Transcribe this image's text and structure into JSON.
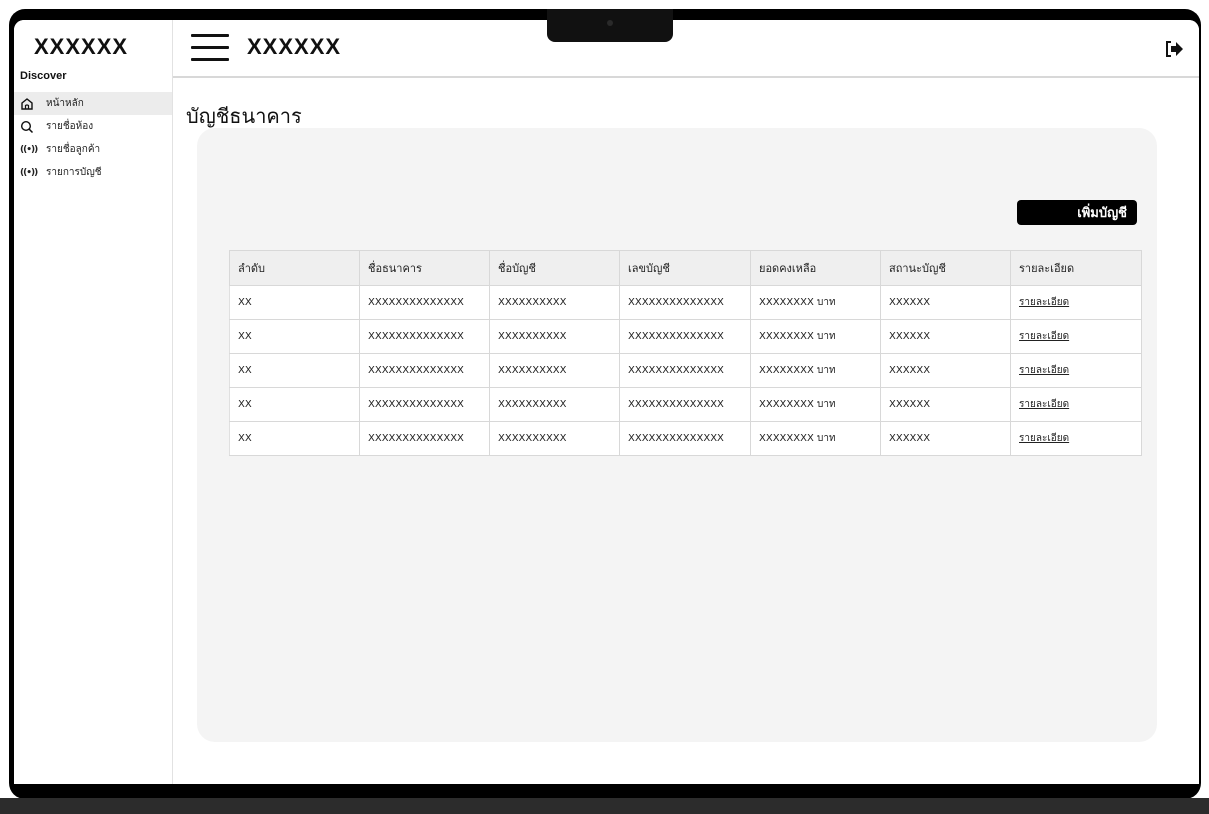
{
  "sidebar": {
    "brand": "XXXXXX",
    "section": "Discover",
    "items": [
      {
        "label": "หน้าหลัก",
        "icon": "home-icon"
      },
      {
        "label": "รายชื่อห้อง",
        "icon": "search-icon"
      },
      {
        "label": "รายชื่อลูกค้า",
        "icon": "broadcast-icon"
      },
      {
        "label": "รายการบัญชี",
        "icon": "broadcast-icon"
      }
    ]
  },
  "header": {
    "title": "XXXXXX",
    "menu_icon": "hamburger-icon",
    "logout_icon": "logout-icon"
  },
  "main": {
    "page_title": "บัญชีธนาคาร",
    "add_button": "เพิ่มบัญชี",
    "table": {
      "columns": [
        "ลำดับ",
        "ชื่อธนาคาร",
        "ชื่อบัญชี",
        "เลขบัญชี",
        "ยอดคงเหลือ",
        "สถานะบัญชี",
        "รายละเอียด"
      ],
      "rows": [
        [
          "XX",
          "XXXXXXXXXXXXXX",
          "XXXXXXXXXX",
          "XXXXXXXXXXXXXX",
          "XXXXXXXX บาท",
          "XXXXXX",
          "รายละเอียด"
        ],
        [
          "XX",
          "XXXXXXXXXXXXXX",
          "XXXXXXXXXX",
          "XXXXXXXXXXXXXX",
          "XXXXXXXX บาท",
          "XXXXXX",
          "รายละเอียด"
        ],
        [
          "XX",
          "XXXXXXXXXXXXXX",
          "XXXXXXXXXX",
          "XXXXXXXXXXXXXX",
          "XXXXXXXX บาท",
          "XXXXXX",
          "รายละเอียด"
        ],
        [
          "XX",
          "XXXXXXXXXXXXXX",
          "XXXXXXXXXX",
          "XXXXXXXXXXXXXX",
          "XXXXXXXX บาท",
          "XXXXXX",
          "รายละเอียด"
        ],
        [
          "XX",
          "XXXXXXXXXXXXXX",
          "XXXXXXXXXX",
          "XXXXXXXXXXXXXX",
          "XXXXXXXX บาท",
          "XXXXXX",
          "รายละเอียด"
        ]
      ]
    }
  },
  "colors": {
    "primary": "#000000",
    "card_bg": "#f4f4f4",
    "active_nav": "#ececec"
  }
}
